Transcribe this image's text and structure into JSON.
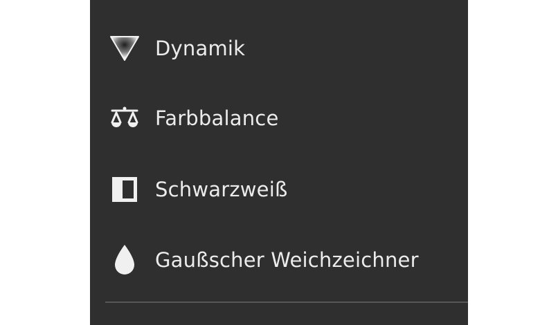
{
  "menu": {
    "items": [
      {
        "label": "Dynamik",
        "icon": "vibrance-triangle-icon"
      },
      {
        "label": "Farbbalance",
        "icon": "balance-scale-icon"
      },
      {
        "label": "Schwarzweiß",
        "icon": "black-white-square-icon"
      },
      {
        "label": "Gaußscher Weichzeichner",
        "icon": "droplet-icon"
      }
    ]
  },
  "colors": {
    "panel_background": "#2f2f2f",
    "text": "#ececec",
    "icon": "#f0f0f0",
    "divider": "#575757",
    "page_background": "#ffffff"
  }
}
